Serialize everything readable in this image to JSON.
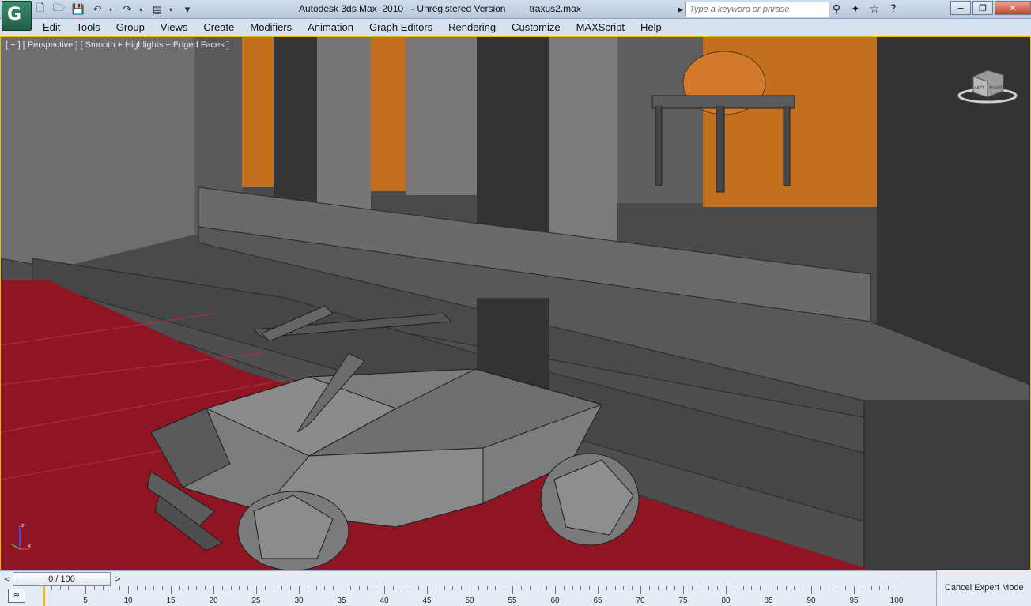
{
  "window": {
    "title": "Autodesk 3ds Max  2010   - Unregistered Version         traxus2.max",
    "logo_letter": "G",
    "controls": [
      "−",
      "❐",
      "✕"
    ]
  },
  "quick_access": {
    "buttons": [
      "new-icon",
      "open-icon",
      "save-icon",
      "undo-icon",
      "redo-icon",
      "project-folder-icon"
    ]
  },
  "search": {
    "placeholder": "Type a keyword or phrase"
  },
  "infocenter": {
    "buttons": [
      "binoculars-icon",
      "communication-center-icon",
      "favorites-star-icon",
      "help-icon"
    ]
  },
  "menubar": {
    "items": [
      "Edit",
      "Tools",
      "Group",
      "Views",
      "Create",
      "Modifiers",
      "Animation",
      "Graph Editors",
      "Rendering",
      "Customize",
      "MAXScript",
      "Help"
    ]
  },
  "viewport": {
    "label": "[ + ] [ Perspective ] [ Smooth + Highlights + Edged Faces ]",
    "viewcube_labels": [
      "LEFT",
      "FRONT"
    ],
    "colors": {
      "background": "#3a3a3a",
      "floor": "#8f1522",
      "walls": "#636363",
      "orange_panels": "#c2701e",
      "dome": "#d27a2c",
      "wire": "#2a2a2a"
    },
    "axis": {
      "z": "z",
      "x": "x"
    }
  },
  "timeslider": {
    "position": "0 / 100",
    "prev": "<",
    "next": ">"
  },
  "trackbar": {
    "ticks": [
      "5",
      "10",
      "15",
      "20",
      "25",
      "30",
      "35",
      "40",
      "45",
      "50",
      "55",
      "60",
      "65",
      "70",
      "75",
      "80",
      "85",
      "90",
      "95",
      "100"
    ]
  },
  "status": {
    "cancel_expert_mode": "Cancel Expert Mode"
  }
}
